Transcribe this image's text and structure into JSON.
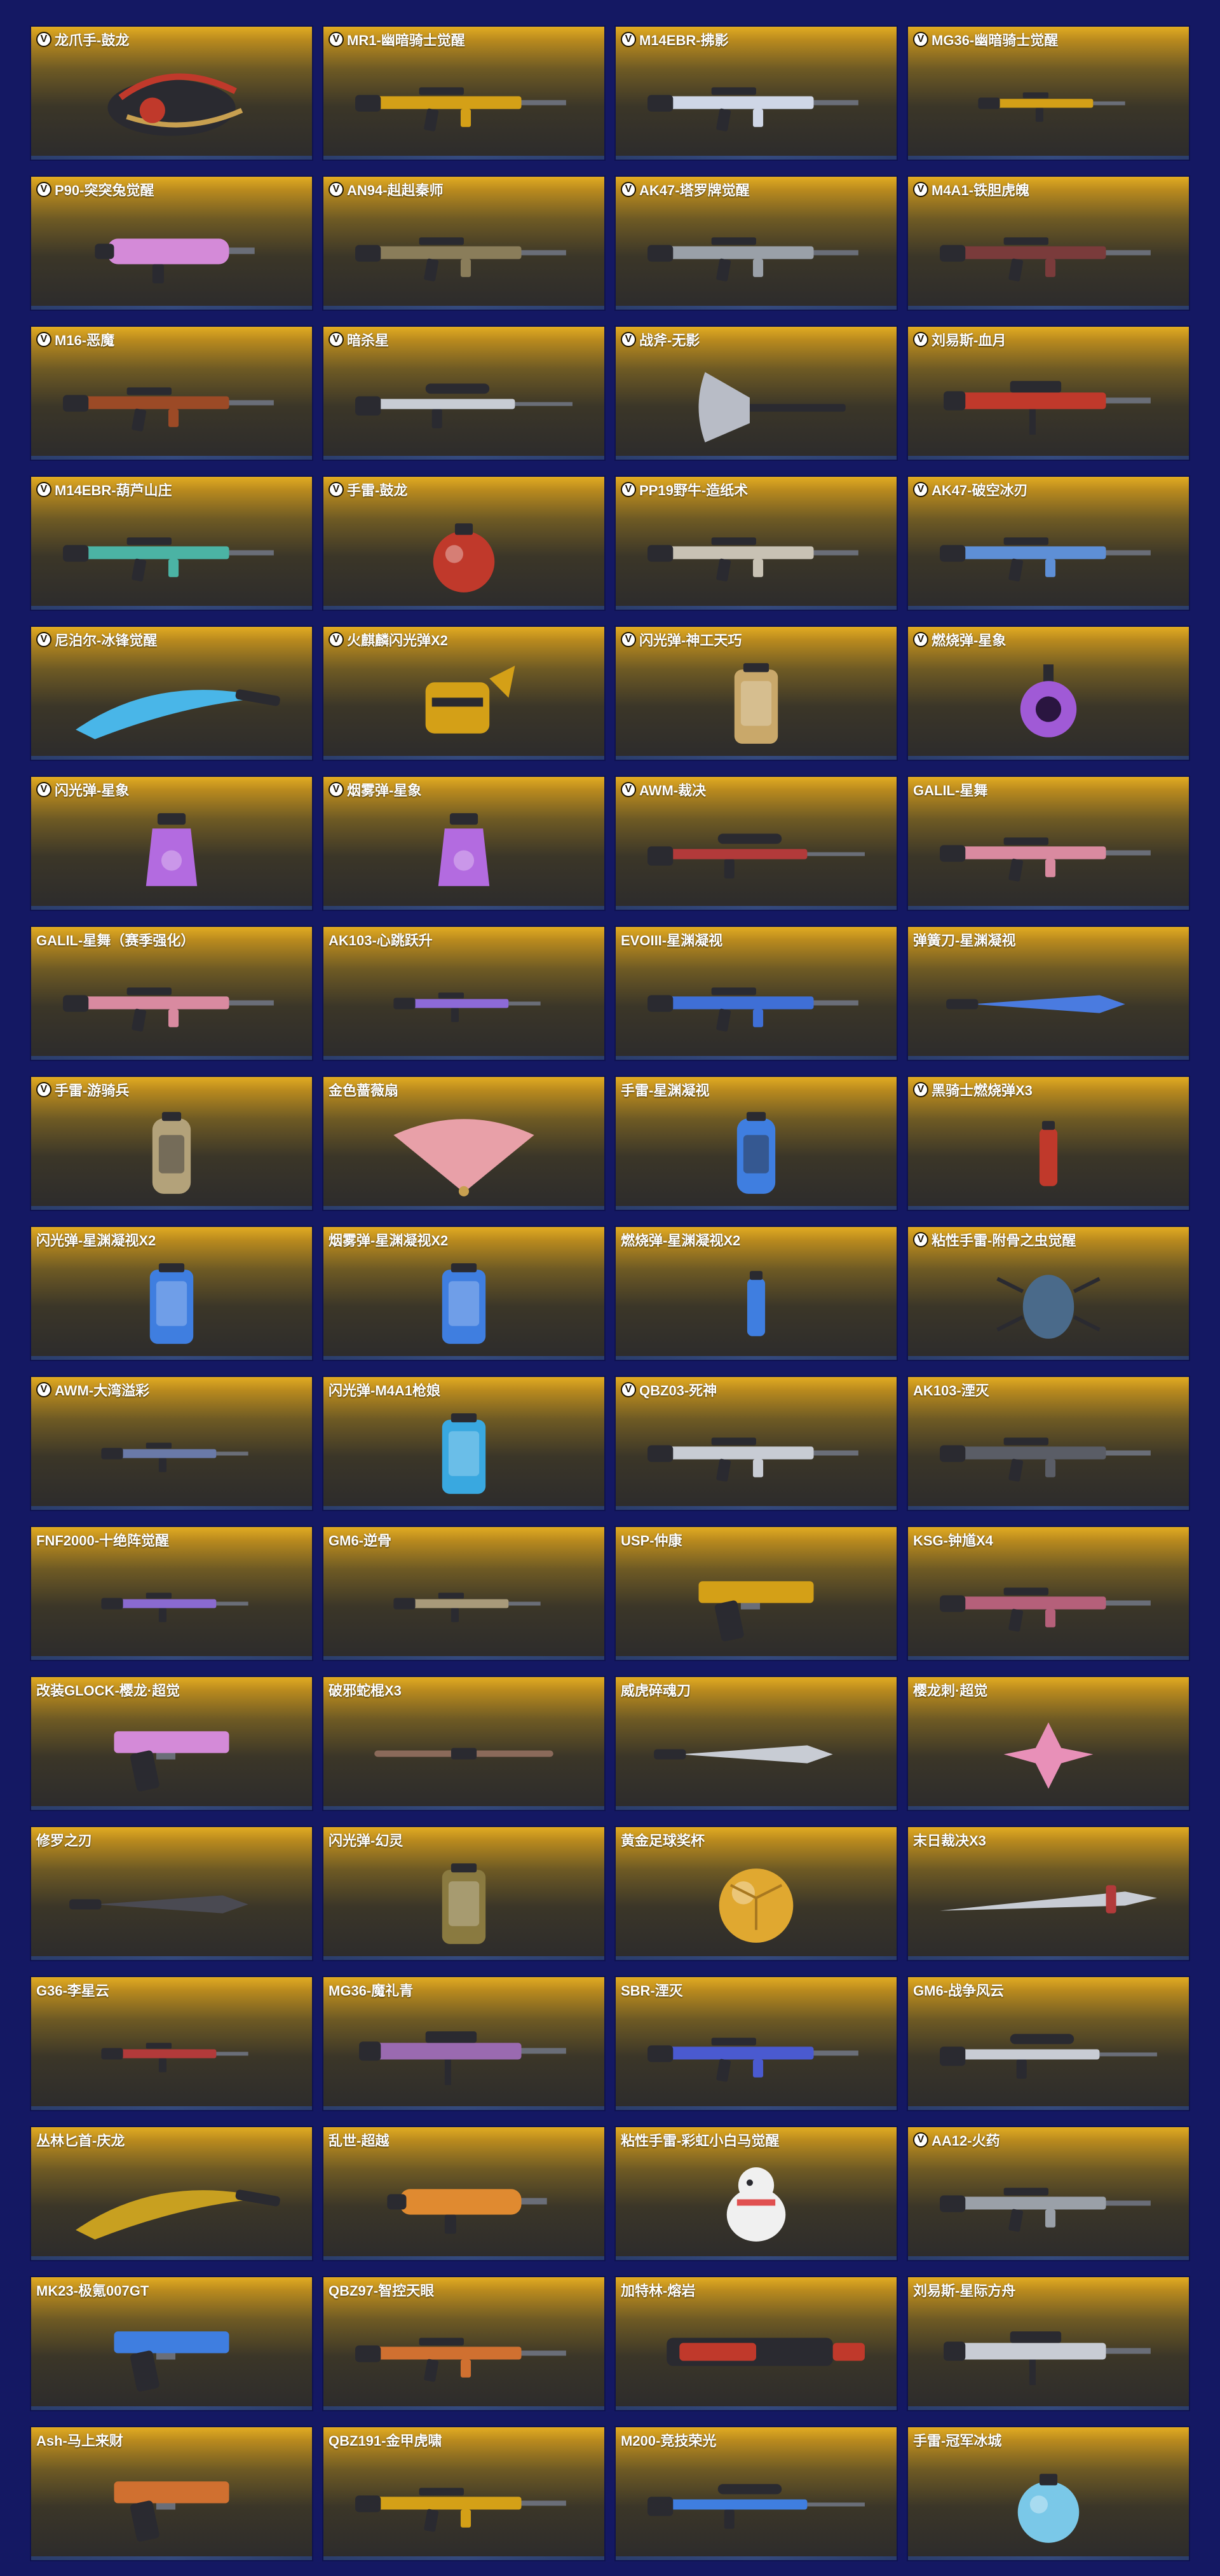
{
  "palette": {
    "page_bg": "#141863",
    "card_top": "#e2ac22",
    "card_bottom": "#2c2b2c",
    "label_text": "#ffffff"
  },
  "items": [
    {
      "name": "龙爪手-鼓龙",
      "badge": "V",
      "art": "claw",
      "color": "#c0392b"
    },
    {
      "name": "MR1-幽暗骑士觉醒",
      "badge": "V",
      "art": "rifle",
      "color": "#d4a017"
    },
    {
      "name": "M14EBR-拂影",
      "badge": "V",
      "art": "rifle",
      "color": "#cfd6e6"
    },
    {
      "name": "MG36-幽暗骑士觉醒",
      "badge": "V",
      "art": "rifle-small",
      "color": "#d4a017"
    },
    {
      "name": "P90-突突兔觉醒",
      "badge": "V",
      "art": "smg",
      "color": "#d48ad8"
    },
    {
      "name": "AN94-赳赳秦师",
      "badge": "V",
      "art": "rifle",
      "color": "#8a7d5a"
    },
    {
      "name": "AK47-塔罗牌觉醒",
      "badge": "V",
      "art": "rifle",
      "color": "#9aa0a8"
    },
    {
      "name": "M4A1-铁胆虎魄",
      "badge": "V",
      "art": "rifle",
      "color": "#7a3b3b"
    },
    {
      "name": "M16-恶魔",
      "badge": "V",
      "art": "rifle",
      "color": "#9c4a26"
    },
    {
      "name": "暗杀星",
      "badge": "V",
      "art": "sniper",
      "color": "#c8ccd4"
    },
    {
      "name": "战斧-无影",
      "badge": "V",
      "art": "axe",
      "color": "#b8bcc6"
    },
    {
      "name": "刘易斯-血月",
      "badge": "V",
      "art": "lmg",
      "color": "#c0392b"
    },
    {
      "name": "M14EBR-葫芦山庄",
      "badge": "V",
      "art": "rifle",
      "color": "#4bb3a4"
    },
    {
      "name": "手雷-鼓龙",
      "badge": "V",
      "art": "grenade-round",
      "color": "#c0392b"
    },
    {
      "name": "PP19野牛-造纸术",
      "badge": "V",
      "art": "rifle",
      "color": "#c8c2b4"
    },
    {
      "name": "AK47-破空冰刃",
      "badge": "V",
      "art": "rifle",
      "color": "#5e8fd6"
    },
    {
      "name": "尼泊尔-冰锋觉醒",
      "badge": "V",
      "art": "blade",
      "color": "#49b6e8"
    },
    {
      "name": "火麒麟闪光弹X2",
      "badge": "V",
      "art": "gauntlet",
      "color": "#d4a017"
    },
    {
      "name": "闪光弹-神工天巧",
      "badge": "V",
      "art": "canister",
      "color": "#c9a86a"
    },
    {
      "name": "燃烧弹-星象",
      "badge": "V",
      "art": "orb",
      "color": "#a05ad6"
    },
    {
      "name": "闪光弹-星象",
      "badge": "V",
      "art": "lantern",
      "color": "#b36be0"
    },
    {
      "name": "烟雾弹-星象",
      "badge": "V",
      "art": "lantern",
      "color": "#b36be0"
    },
    {
      "name": "AWM-裁决",
      "badge": "V",
      "art": "sniper",
      "color": "#b23a3a"
    },
    {
      "name": "GALIL-星舞",
      "badge": "",
      "art": "rifle",
      "color": "#d98aa0"
    },
    {
      "name": "GALIL-星舞（赛季强化）",
      "badge": "",
      "art": "rifle",
      "color": "#d98aa0"
    },
    {
      "name": "AK103-心跳跃升",
      "badge": "",
      "art": "rifle-small",
      "color": "#8d6ad8"
    },
    {
      "name": "EVOIII-星渊凝视",
      "badge": "",
      "art": "rifle",
      "color": "#3f6fd6"
    },
    {
      "name": "弹簧刀-星渊凝视",
      "badge": "",
      "art": "knife",
      "color": "#4a7be0"
    },
    {
      "name": "手雷-游骑兵",
      "badge": "V",
      "art": "grenade-tall",
      "color": "#b3a27a"
    },
    {
      "name": "金色蔷薇扇",
      "badge": "",
      "art": "fan",
      "color": "#e8a0a8"
    },
    {
      "name": "手雷-星渊凝视",
      "badge": "",
      "art": "grenade-tall",
      "color": "#3f7ee0"
    },
    {
      "name": "黑骑士燃烧弹X3",
      "badge": "V",
      "art": "vial",
      "color": "#c0392b"
    },
    {
      "name": "闪光弹-星渊凝视X2",
      "badge": "",
      "art": "canister",
      "color": "#3f7ee0"
    },
    {
      "name": "烟雾弹-星渊凝视X2",
      "badge": "",
      "art": "canister",
      "color": "#3f7ee0"
    },
    {
      "name": "燃烧弹-星渊凝视X2",
      "badge": "",
      "art": "vial",
      "color": "#3f7ee0"
    },
    {
      "name": "粘性手雷-附骨之虫觉醒",
      "badge": "V",
      "art": "bug",
      "color": "#4a6a8a"
    },
    {
      "name": "AWM-大湾溢彩",
      "badge": "V",
      "art": "rifle-small",
      "color": "#6a7aa8"
    },
    {
      "name": "闪光弹-M4A1枪娘",
      "badge": "",
      "art": "canister",
      "color": "#39a8e0"
    },
    {
      "name": "QBZ03-死神",
      "badge": "V",
      "art": "rifle",
      "color": "#c8ccd4"
    },
    {
      "name": "AK103-湮灭",
      "badge": "",
      "art": "rifle",
      "color": "#5a5d66"
    },
    {
      "name": "FNF2000-十绝阵觉醒",
      "badge": "",
      "art": "rifle-small",
      "color": "#8a6ad0"
    },
    {
      "name": "GM6-逆骨",
      "badge": "",
      "art": "rifle-small",
      "color": "#a89a7a"
    },
    {
      "name": "USP-仲康",
      "badge": "",
      "art": "pistol",
      "color": "#d4a017"
    },
    {
      "name": "KSG-钟馗X4",
      "badge": "",
      "art": "rifle",
      "color": "#b5607a"
    },
    {
      "name": "改装GLOCK-樱龙·超觉",
      "badge": "",
      "art": "pistol",
      "color": "#d48ad8"
    },
    {
      "name": "破邪蛇棍X3",
      "badge": "",
      "art": "staff",
      "color": "#8a6a5a"
    },
    {
      "name": "威虎碎魂刀",
      "badge": "",
      "art": "knife",
      "color": "#c8ccd4"
    },
    {
      "name": "樱龙刺·超觉",
      "badge": "",
      "art": "star",
      "color": "#e890b8"
    },
    {
      "name": "修罗之刃",
      "badge": "",
      "art": "knife",
      "color": "#4a4a52"
    },
    {
      "name": "闪光弹-幻灵",
      "badge": "",
      "art": "canister",
      "color": "#8a7a40"
    },
    {
      "name": "黄金足球奖杯",
      "badge": "",
      "art": "ball",
      "color": "#e0a830"
    },
    {
      "name": "末日裁决X3",
      "badge": "",
      "art": "sword",
      "color": "#c8ccd4"
    },
    {
      "name": "G36-李星云",
      "badge": "",
      "art": "rifle-small",
      "color": "#b23a3a"
    },
    {
      "name": "MG36-魔礼青",
      "badge": "",
      "art": "lmg",
      "color": "#9a6ab0"
    },
    {
      "name": "SBR-湮灭",
      "badge": "",
      "art": "rifle",
      "color": "#4a5ad0"
    },
    {
      "name": "GM6-战争风云",
      "badge": "",
      "art": "sniper",
      "color": "#c8ccd4"
    },
    {
      "name": "丛林匕首-庆龙",
      "badge": "",
      "art": "blade",
      "color": "#c8a020"
    },
    {
      "name": "乱世-超越",
      "badge": "",
      "art": "smg",
      "color": "#e08a30"
    },
    {
      "name": "粘性手雷-彩虹小白马觉醒",
      "badge": "",
      "art": "mascot",
      "color": "#f0f0f0"
    },
    {
      "name": "AA12-火药",
      "badge": "V",
      "art": "rifle",
      "color": "#9aa0a8"
    },
    {
      "name": "MK23-极氪007GT",
      "badge": "",
      "art": "pistol",
      "color": "#3f7ee0"
    },
    {
      "name": "QBZ97-智控天眼",
      "badge": "",
      "art": "rifle",
      "color": "#d07030"
    },
    {
      "name": "加特林-熔岩",
      "badge": "",
      "art": "gatling",
      "color": "#c0392b"
    },
    {
      "name": "刘易斯-星际方舟",
      "badge": "",
      "art": "lmg",
      "color": "#c8ccd4"
    },
    {
      "name": "Ash-马上来财",
      "badge": "",
      "art": "pistol",
      "color": "#d07030"
    },
    {
      "name": "QBZ191-金甲虎啸",
      "badge": "",
      "art": "rifle",
      "color": "#d4a017"
    },
    {
      "name": "M200-竞技荣光",
      "badge": "",
      "art": "sniper",
      "color": "#3f7ee0"
    },
    {
      "name": "手雷-冠军冰城",
      "badge": "",
      "art": "grenade-round",
      "color": "#7ac8e8"
    }
  ]
}
